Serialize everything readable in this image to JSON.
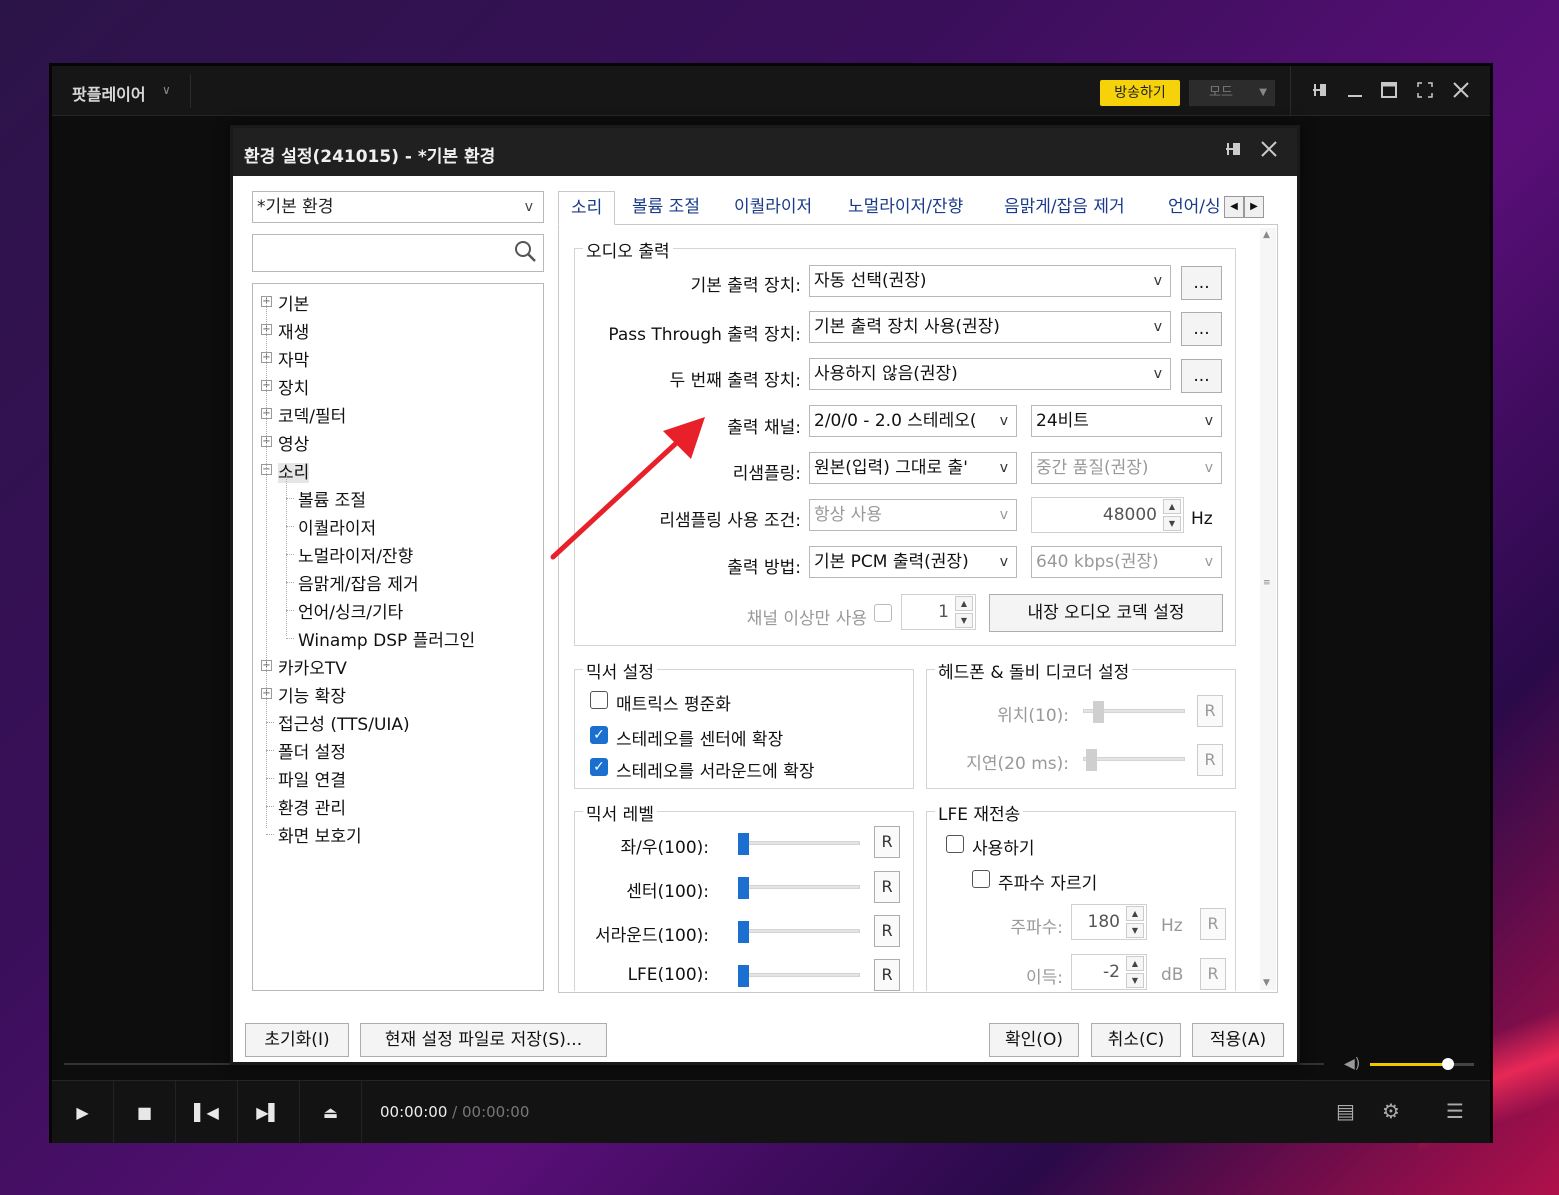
{
  "player": {
    "app_name": "팟플레이어",
    "broadcast": "방송하기",
    "mode": "모드",
    "time_current": "00:00:00",
    "time_sep": "/",
    "time_total": "00:00:00",
    "volume_fraction": 0.75
  },
  "dialog": {
    "title": "환경 설정(241015) - *기본 환경",
    "profile": "*기본 환경",
    "tree": [
      {
        "label": "기본",
        "expand": "+"
      },
      {
        "label": "재생",
        "expand": "+"
      },
      {
        "label": "자막",
        "expand": "+"
      },
      {
        "label": "장치",
        "expand": "+"
      },
      {
        "label": "코덱/필터",
        "expand": "+"
      },
      {
        "label": "영상",
        "expand": "+"
      },
      {
        "label": "소리",
        "expand": "−"
      },
      {
        "label": "볼륨 조절"
      },
      {
        "label": "이퀄라이저"
      },
      {
        "label": "노멀라이저/잔향"
      },
      {
        "label": "음맑게/잡음 제거"
      },
      {
        "label": "언어/싱크/기타"
      },
      {
        "label": "Winamp DSP 플러그인"
      },
      {
        "label": "카카오TV",
        "expand": "+"
      },
      {
        "label": "기능 확장",
        "expand": "+"
      },
      {
        "label": "접근성 (TTS/UIA)"
      },
      {
        "label": "폴더 설정"
      },
      {
        "label": "파일 연결"
      },
      {
        "label": "환경 관리"
      },
      {
        "label": "화면 보호기"
      }
    ],
    "tabs": [
      "소리",
      "볼륨 조절",
      "이퀄라이저",
      "노멀라이저/잔향",
      "음맑게/잡음 제거",
      "언어/싱"
    ],
    "audio_output": {
      "title": "오디오 출력",
      "default_device_label": "기본 출력 장치:",
      "default_device_value": "자동 선택(권장)",
      "passthrough_label": "Pass Through 출력 장치:",
      "passthrough_value": "기본 출력 장치 사용(권장)",
      "second_device_label": "두 번째 출력 장치:",
      "second_device_value": "사용하지 않음(권장)",
      "ellipsis": "...",
      "channel_label": "출력 채널:",
      "channel_value": "2/0/0 - 2.0 스테레오(",
      "bits_value": "24비트",
      "resample_label": "리샘플링:",
      "resample_value": "원본(입력) 그대로 출'",
      "quality_value": "중간 품질(권장)",
      "resample_cond_label": "리샘플링 사용 조건:",
      "resample_cond_value": "항상 사용",
      "rate_value": "48000",
      "rate_unit": "Hz",
      "output_method_label": "출력 방법:",
      "output_method_value": "기본 PCM 출력(권장)",
      "bitrate_value": "640 kbps(권장)",
      "channel_only_label": "채널 이상만 사용",
      "channel_only_value": "1",
      "codec_button": "내장 오디오 코덱 설정"
    },
    "mixer_settings": {
      "title": "믹서 설정",
      "matrix": "매트릭스 평준화",
      "stereo_center": "스테레오를 센터에 확장",
      "stereo_surround": "스테레오를 서라운드에 확장"
    },
    "headphone": {
      "title": "헤드폰 & 돌비 디코더 설정",
      "position_label": "위치(10):",
      "delay_label": "지연(20 ms):",
      "reset": "R"
    },
    "mixer_level": {
      "title": "믹서 레벨",
      "lr": "좌/우(100):",
      "center": "센터(100):",
      "surround": "서라운드(100):",
      "lfe": "LFE(100):",
      "reset": "R"
    },
    "lfe": {
      "title": "LFE 재전송",
      "use": "사용하기",
      "cut": "주파수 자르기",
      "freq_label": "주파수:",
      "freq_value": "180",
      "freq_unit": "Hz",
      "gain_label": "이득:",
      "gain_value": "-2",
      "gain_unit": "dB",
      "reset": "R"
    },
    "buttons": {
      "reset": "초기화(I)",
      "save": "현재 설정 파일로 저장(S)...",
      "ok": "확인(O)",
      "cancel": "취소(C)",
      "apply": "적용(A)"
    }
  },
  "colors": {
    "accent": "#1a6fd0",
    "broadcast": "#f5d20a",
    "annotation_arrow": "#e8202a"
  },
  "icons": [
    "pin-icon",
    "minimize-icon",
    "maximize-icon",
    "fullscreen-icon",
    "close-icon",
    "search-icon",
    "play-icon",
    "stop-icon",
    "prev-icon",
    "next-icon",
    "eject-icon",
    "playlist-icon",
    "gear-icon",
    "menu-icon",
    "volume-icon"
  ]
}
